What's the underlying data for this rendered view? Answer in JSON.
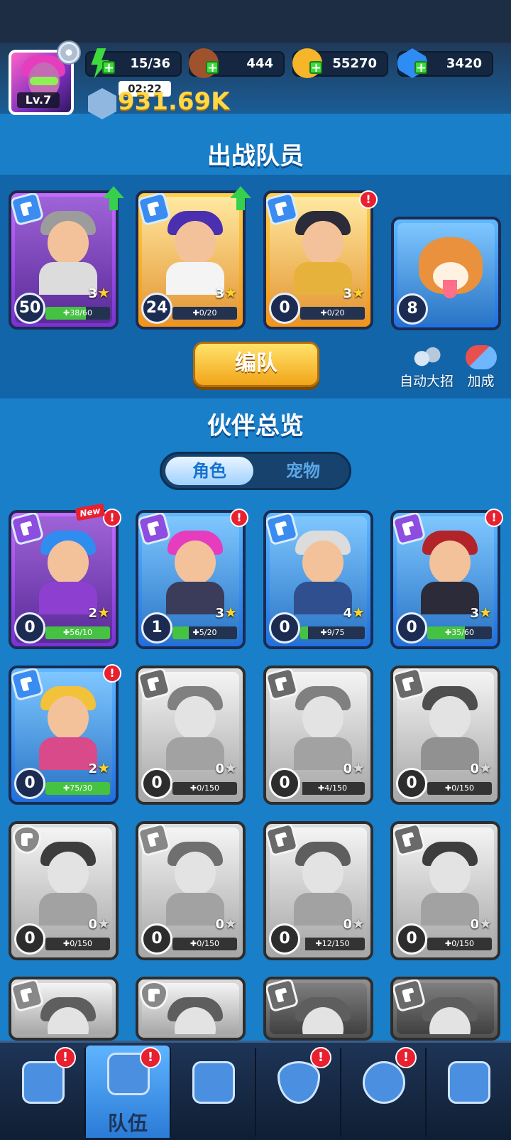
{
  "player": {
    "level": "Lv.7",
    "power": "931.69K",
    "timer": "02:22"
  },
  "resources": [
    {
      "name": "energy",
      "value": "15/36",
      "icon": "lightning-icon",
      "color": "#3ddb3d"
    },
    {
      "name": "exp-food",
      "value": "444",
      "icon": "exp-bowl-icon",
      "color": "#a0522d"
    },
    {
      "name": "gold",
      "value": "55270",
      "icon": "gold-coin-icon",
      "color": "#f7b52a"
    },
    {
      "name": "gems",
      "value": "3420",
      "icon": "blue-gem-icon",
      "color": "#2e8cf5"
    }
  ],
  "lineup": {
    "title": "出战队员",
    "members": [
      {
        "level": "50",
        "stars": "3",
        "shards": "38/60",
        "progress": 0.63,
        "frame": "purple",
        "upgrade": true,
        "alert": false,
        "hair": "#9c9c9c",
        "body": "#dcdcdc"
      },
      {
        "level": "24",
        "stars": "3",
        "shards": "0/20",
        "progress": 0,
        "frame": "orange",
        "upgrade": true,
        "alert": false,
        "hair": "#4a2fb0",
        "body": "#f4f4f4"
      },
      {
        "level": "0",
        "stars": "3",
        "shards": "0/20",
        "progress": 0,
        "frame": "orange",
        "upgrade": false,
        "alert": true,
        "hair": "#2b2b3a",
        "body": "#e6b23b"
      }
    ],
    "pet": {
      "level": "8"
    },
    "team_button": "编队",
    "auto_ult_label": "自动大招",
    "bonus_label": "加成"
  },
  "overview": {
    "title": "伙伴总览",
    "tabs": {
      "active": "角色",
      "inactive": "宠物"
    },
    "new_tag": "New",
    "cards": [
      {
        "level": "0",
        "stars": "2",
        "shards": "56/10",
        "progress": 1.0,
        "frame": "purple",
        "gray": false,
        "alert": true,
        "isnew": true,
        "cls": "p",
        "hair": "#2f8df0",
        "body": "#8d3fd0"
      },
      {
        "level": "1",
        "stars": "3",
        "shards": "5/20",
        "progress": 0.25,
        "frame": "blue",
        "gray": false,
        "alert": true,
        "isnew": false,
        "cls": "p",
        "hair": "#e63dbf",
        "body": "#3b3b5a"
      },
      {
        "level": "0",
        "stars": "4",
        "shards": "9/75",
        "progress": 0.12,
        "frame": "blue",
        "gray": false,
        "alert": false,
        "isnew": false,
        "cls": "b",
        "hair": "#dcdcdc",
        "body": "#2f4f8f"
      },
      {
        "level": "0",
        "stars": "3",
        "shards": "35/60",
        "progress": 0.58,
        "frame": "blue",
        "gray": false,
        "alert": true,
        "isnew": false,
        "cls": "p",
        "hair": "#b3242a",
        "body": "#2b2b3a"
      },
      {
        "level": "0",
        "stars": "2",
        "shards": "75/30",
        "progress": 1.0,
        "frame": "blue",
        "gray": false,
        "alert": true,
        "isnew": false,
        "cls": "b",
        "hair": "#f2c23a",
        "body": "#d94a8a"
      },
      {
        "level": "0",
        "stars": "0",
        "shards": "0/150",
        "progress": 0,
        "frame": "orange",
        "gray": true,
        "alert": false,
        "isnew": false,
        "cls": "p",
        "hair": "#7a7a7a",
        "body": "#9a9a9a"
      },
      {
        "level": "0",
        "stars": "0",
        "shards": "4/150",
        "progress": 0.03,
        "frame": "orange",
        "gray": true,
        "alert": false,
        "isnew": false,
        "cls": "p",
        "hair": "#7a7a7a",
        "body": "#9a9a9a"
      },
      {
        "level": "0",
        "stars": "0",
        "shards": "0/150",
        "progress": 0,
        "frame": "orange",
        "gray": true,
        "alert": false,
        "isnew": false,
        "cls": "p",
        "hair": "#4a4a4a",
        "body": "#8a8a8a"
      },
      {
        "level": "0",
        "stars": "0",
        "shards": "0/150",
        "progress": 0,
        "frame": "orange",
        "gray": true,
        "alert": false,
        "isnew": false,
        "cls": "sh",
        "hair": "#3a3a3a",
        "body": "#9a9a9a"
      },
      {
        "level": "0",
        "stars": "0",
        "shards": "0/150",
        "progress": 0,
        "frame": "orange",
        "gray": true,
        "alert": false,
        "isnew": false,
        "cls": "b",
        "hair": "#6a6a6a",
        "body": "#9a9a9a"
      },
      {
        "level": "0",
        "stars": "0",
        "shards": "12/150",
        "progress": 0.08,
        "frame": "orange",
        "gray": true,
        "alert": false,
        "isnew": false,
        "cls": "p",
        "hair": "#5a5a5a",
        "body": "#9a9a9a"
      },
      {
        "level": "0",
        "stars": "0",
        "shards": "0/150",
        "progress": 0,
        "frame": "orange",
        "gray": true,
        "alert": false,
        "isnew": false,
        "cls": "p",
        "hair": "#3a3a3a",
        "body": "#9a9a9a"
      }
    ],
    "partial_row": [
      {
        "frame": "orange",
        "cls": "b"
      },
      {
        "frame": "orange",
        "cls": "sh"
      },
      {
        "frame": "purple",
        "cls": "p"
      },
      {
        "frame": "purple",
        "cls": "p"
      }
    ]
  },
  "nav": [
    {
      "icon": "tv-icon",
      "label": "",
      "alert": true,
      "active": false
    },
    {
      "icon": "team-icon",
      "label": "队伍",
      "alert": true,
      "active": true
    },
    {
      "icon": "map-icon",
      "label": "",
      "alert": false,
      "active": false
    },
    {
      "icon": "shield-icon",
      "label": "",
      "alert": true,
      "active": false
    },
    {
      "icon": "target-icon",
      "label": "",
      "alert": true,
      "active": false
    },
    {
      "icon": "lock-icon",
      "label": "",
      "alert": false,
      "active": false
    }
  ],
  "alert_mark": "!",
  "plus_mark": "+",
  "star_glyph": "★",
  "shard_glyph": "✚"
}
